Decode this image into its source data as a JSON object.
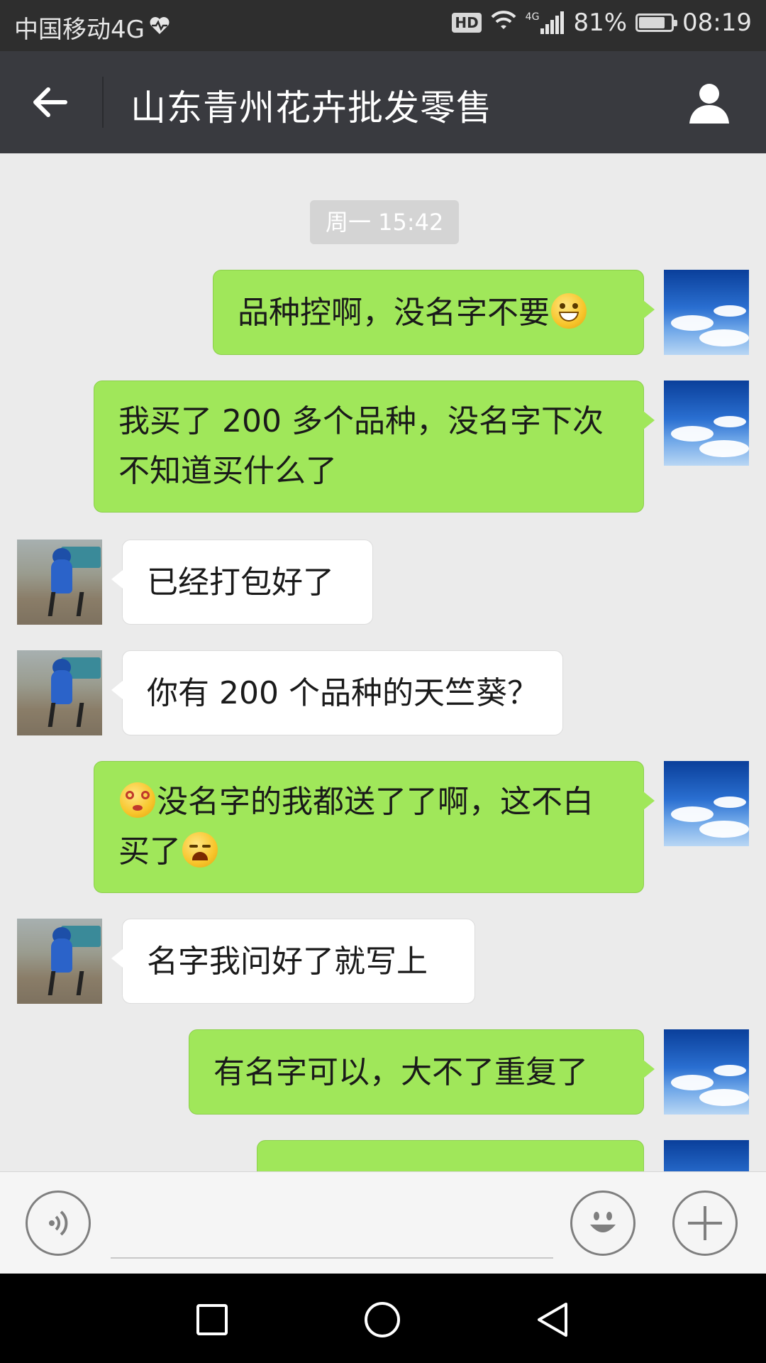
{
  "status_bar": {
    "carrier": "中国移动4G",
    "hd": "HD",
    "network": "4G",
    "battery_percent": "81%",
    "battery_level": 0.81,
    "time": "08:19"
  },
  "header": {
    "title": "山东青州花卉批发零售"
  },
  "chat": {
    "timestamp": "周一 15:42",
    "messages": [
      {
        "side": "out",
        "line1": "品种控啊，没名字不要",
        "emoji_after": "grinning"
      },
      {
        "side": "out",
        "line1": "我买了 200 多个品种，没名字下次",
        "line2": "不知道买什么了"
      },
      {
        "side": "in",
        "line1": "已经打包好了"
      },
      {
        "side": "in",
        "line1": "你有 200 个品种的天竺葵？"
      },
      {
        "side": "out",
        "emoji_before": "dizzy",
        "line1": "没名字的我都送了了啊，这不白",
        "line2": "买了",
        "emoji_after": "crying"
      },
      {
        "side": "in",
        "line1": "名字我问好了就写上"
      },
      {
        "side": "out",
        "line1": "有名字可以，大不了重复了"
      }
    ]
  },
  "input_bar": {
    "voice_icon": "voice-icon",
    "emoji_icon": "smiley-icon",
    "plus_icon": "plus-icon"
  },
  "nav_bar": {
    "icons": [
      "recent-apps-icon",
      "home-icon",
      "back-icon"
    ]
  },
  "colors": {
    "title_bar": "#393a3f",
    "status_bar": "#2e2e2e",
    "bubble_out": "#a0e75a",
    "bubble_in": "#ffffff",
    "chat_bg": "#ebebeb"
  }
}
